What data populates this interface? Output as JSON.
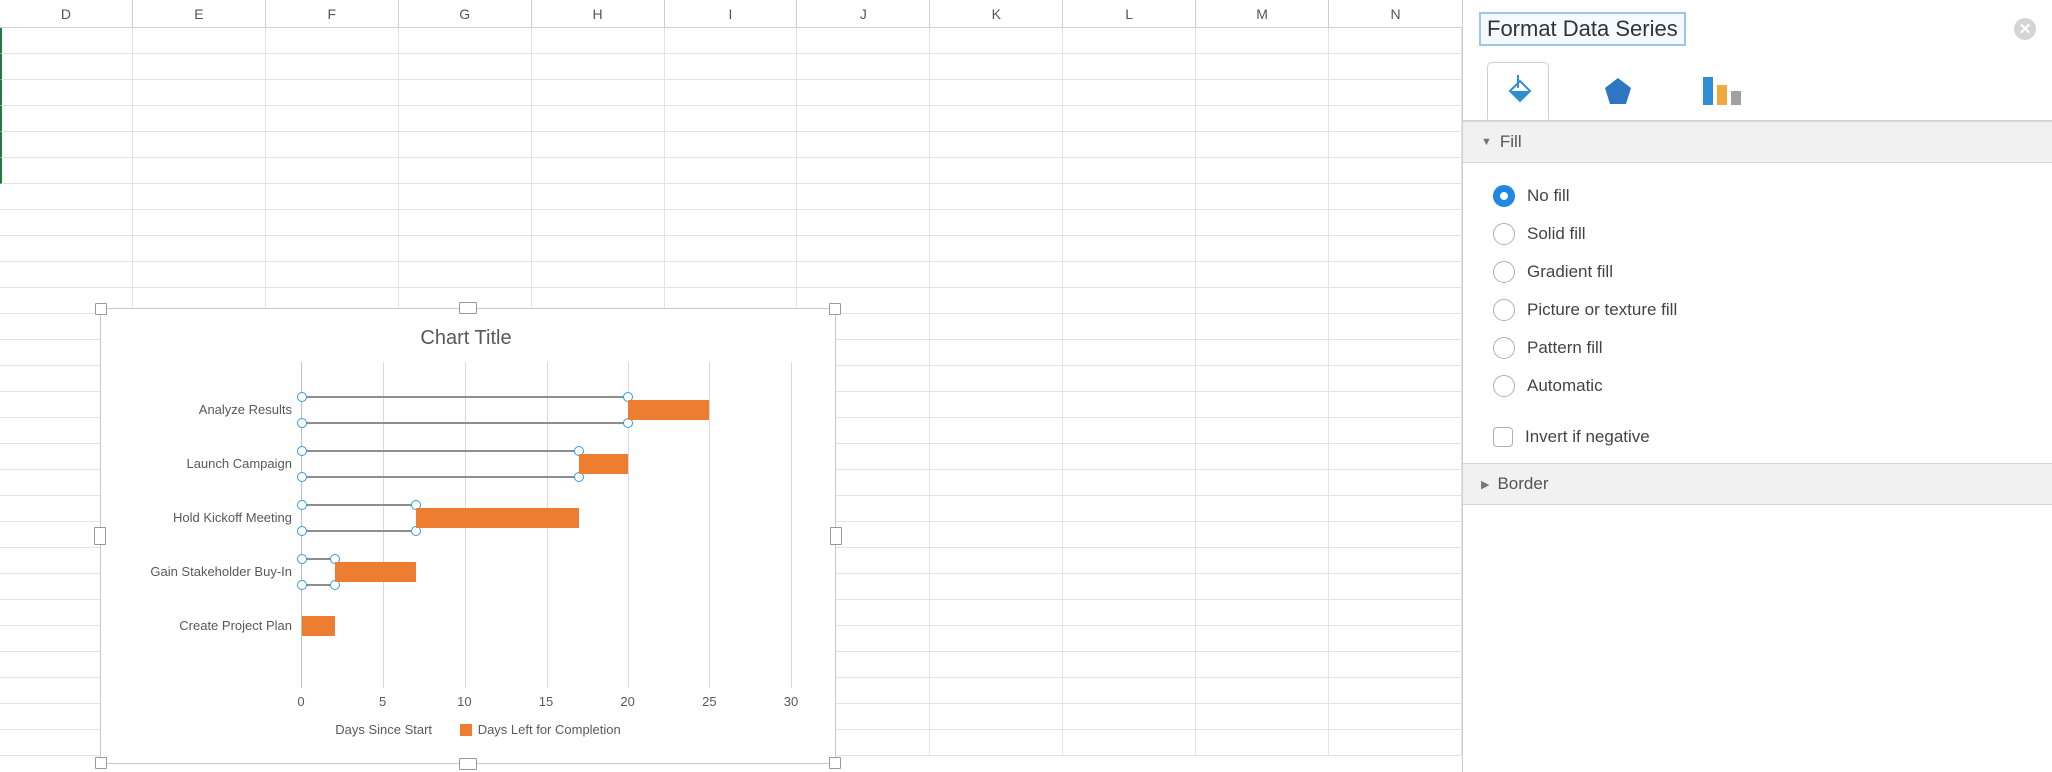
{
  "columns": [
    "D",
    "E",
    "F",
    "G",
    "H",
    "I",
    "J",
    "K",
    "L",
    "M",
    "N"
  ],
  "sidebar": {
    "title": "Format Data Series",
    "tabs": {
      "fill_shape": "fill-shape",
      "effects": "effects",
      "series": "series"
    },
    "sections": {
      "fill": "Fill",
      "border": "Border"
    },
    "fill_options": {
      "no_fill": "No fill",
      "solid": "Solid fill",
      "gradient": "Gradient fill",
      "picture": "Picture or texture fill",
      "pattern": "Pattern fill",
      "auto": "Automatic"
    },
    "invert_label": "Invert if negative"
  },
  "chart": {
    "title": "Chart Title",
    "legend": {
      "series1": "Days Since Start",
      "series2": "Days Left for Completion"
    },
    "x_ticks": [
      "0",
      "5",
      "10",
      "15",
      "20",
      "25",
      "30"
    ]
  },
  "chart_data": {
    "type": "bar",
    "title": "Chart Title",
    "xlabel": "",
    "ylabel": "",
    "xlim": [
      0,
      30
    ],
    "categories": [
      "Analyze Results",
      "Launch Campaign",
      "Hold Kickoff Meeting",
      "Gain Stakeholder Buy-In",
      "Create Project Plan"
    ],
    "series": [
      {
        "name": "Days Since Start",
        "values": [
          20,
          17,
          7,
          2,
          0
        ]
      },
      {
        "name": "Days Left for Completion",
        "values": [
          5,
          3,
          10,
          5,
          2
        ]
      }
    ]
  }
}
